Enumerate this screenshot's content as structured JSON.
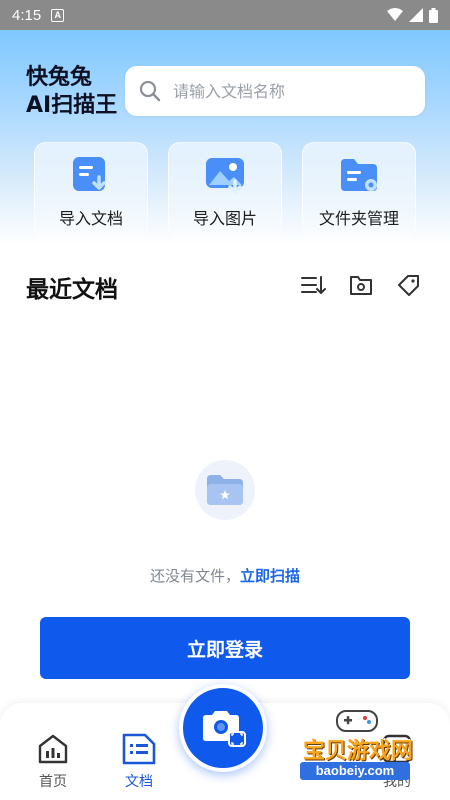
{
  "status_bar": {
    "time": "4:15",
    "badge": "A"
  },
  "brand": {
    "line1": "快兔兔",
    "line2": "AI扫描王"
  },
  "search": {
    "placeholder": "请输入文档名称"
  },
  "quick_actions": [
    {
      "label": "导入文档",
      "icon": "import-doc-icon"
    },
    {
      "label": "导入图片",
      "icon": "import-image-icon"
    },
    {
      "label": "文件夹管理",
      "icon": "folder-manage-icon"
    }
  ],
  "recent": {
    "title": "最近文档",
    "tools": [
      "sort-icon",
      "folder-icon",
      "tag-icon"
    ]
  },
  "empty_state": {
    "text": "还没有文件，",
    "link": "立即扫描"
  },
  "login_button": "立即登录",
  "bottom_nav": {
    "items": [
      {
        "label": "首页",
        "icon": "home-icon",
        "active": false
      },
      {
        "label": "文档",
        "icon": "docs-icon",
        "active": true
      },
      {
        "label": "我的",
        "icon": "profile-icon",
        "active": false
      }
    ],
    "fab_icon": "camera-scan-icon"
  },
  "watermark": {
    "text": "宝贝游戏网",
    "url": "baobeiy.com"
  },
  "colors": {
    "primary": "#0f59ec",
    "link": "#1b66e8",
    "hero_top": "#7fc8ff"
  }
}
